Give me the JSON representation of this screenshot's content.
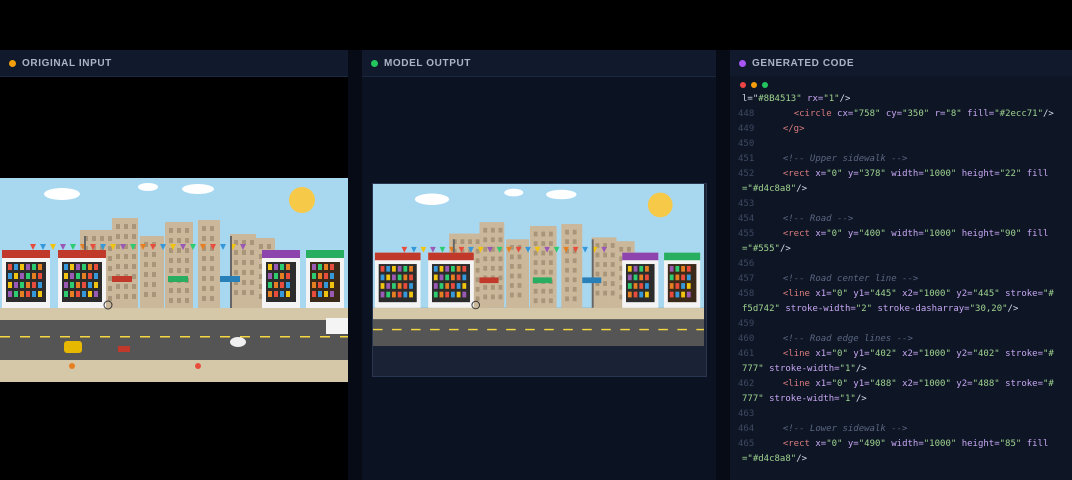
{
  "panels": {
    "input": {
      "title": "ORIGINAL INPUT",
      "dot_color": "#f59e0b"
    },
    "output": {
      "title": "MODEL OUTPUT",
      "dot_color": "#22c55e"
    },
    "code": {
      "title": "GENERATED CODE",
      "dot_color": "#a855f7"
    }
  },
  "scene": {
    "input_shops": [
      {
        "sign": "",
        "sign_color": "#c0392b"
      },
      {
        "sign": "",
        "sign_color": "#c0392b"
      },
      {
        "sign": "",
        "sign_color": "#8e44ad"
      },
      {
        "sign": "",
        "sign_color": "#27ae60"
      }
    ],
    "output_shops": [
      {
        "sign": "",
        "sign_color": "#c0392b"
      },
      {
        "sign": "",
        "sign_color": "#c0392b"
      },
      {
        "sign": "",
        "sign_color": "#8e44ad"
      },
      {
        "sign": "",
        "sign_color": "#27ae60"
      }
    ],
    "colors": {
      "sky": "#a7d8f0",
      "sun": "#f7c948",
      "road": "#555555",
      "sidewalk": "#d4c8a8",
      "building": "#cbb79a",
      "centerline": "#f5d742"
    }
  },
  "code_lines": [
    {
      "num": "",
      "indent": "cont",
      "parts": [
        [
          "txt",
          "l=\""
        ],
        [
          "val",
          "#8B4513\""
        ],
        [
          "attr",
          " rx="
        ],
        [
          "val",
          "\"1\""
        ],
        [
          "txt",
          "/>"
        ]
      ]
    },
    {
      "num": "448",
      "parts": [
        [
          "txt",
          "    "
        ],
        [
          "tag",
          "<circle"
        ],
        [
          "attr",
          " cx="
        ],
        [
          "val",
          "\"758\""
        ],
        [
          "attr",
          " cy="
        ],
        [
          "val",
          "\"350\""
        ],
        [
          "attr",
          " r="
        ],
        [
          "val",
          "\"8\""
        ],
        [
          "attr",
          " fill="
        ],
        [
          "val",
          "\"#2ecc71\""
        ],
        [
          "txt",
          "/>"
        ]
      ]
    },
    {
      "num": "449",
      "parts": [
        [
          "txt",
          "  "
        ],
        [
          "tag",
          "</g>"
        ]
      ]
    },
    {
      "num": "450",
      "parts": []
    },
    {
      "num": "451",
      "parts": [
        [
          "comment",
          "  <!-- Upper sidewalk -->"
        ]
      ]
    },
    {
      "num": "452",
      "parts": [
        [
          "txt",
          "  "
        ],
        [
          "tag",
          "<rect"
        ],
        [
          "attr",
          " x="
        ],
        [
          "val",
          "\"0\""
        ],
        [
          "attr",
          " y="
        ],
        [
          "val",
          "\"378\""
        ],
        [
          "attr",
          " width="
        ],
        [
          "val",
          "\"1000\""
        ],
        [
          "attr",
          " height="
        ],
        [
          "val",
          "\"22\""
        ],
        [
          "attr",
          " fill"
        ]
      ]
    },
    {
      "num": "",
      "indent": "cont",
      "parts": [
        [
          "val",
          "=\"#d4c8a8\""
        ],
        [
          "txt",
          "/>"
        ]
      ]
    },
    {
      "num": "453",
      "parts": []
    },
    {
      "num": "454",
      "parts": [
        [
          "comment",
          "  <!-- Road -->"
        ]
      ]
    },
    {
      "num": "455",
      "parts": [
        [
          "txt",
          "  "
        ],
        [
          "tag",
          "<rect"
        ],
        [
          "attr",
          " x="
        ],
        [
          "val",
          "\"0\""
        ],
        [
          "attr",
          " y="
        ],
        [
          "val",
          "\"400\""
        ],
        [
          "attr",
          " width="
        ],
        [
          "val",
          "\"1000\""
        ],
        [
          "attr",
          " height="
        ],
        [
          "val",
          "\"90\""
        ],
        [
          "attr",
          " fill"
        ]
      ]
    },
    {
      "num": "",
      "indent": "cont",
      "parts": [
        [
          "val",
          "=\"#555\""
        ],
        [
          "txt",
          "/>"
        ]
      ]
    },
    {
      "num": "456",
      "parts": []
    },
    {
      "num": "457",
      "parts": [
        [
          "comment",
          "  <!-- Road center line -->"
        ]
      ]
    },
    {
      "num": "458",
      "parts": [
        [
          "txt",
          "  "
        ],
        [
          "tag",
          "<line"
        ],
        [
          "attr",
          " x1="
        ],
        [
          "val",
          "\"0\""
        ],
        [
          "attr",
          " y1="
        ],
        [
          "val",
          "\"445\""
        ],
        [
          "attr",
          " x2="
        ],
        [
          "val",
          "\"1000\""
        ],
        [
          "attr",
          " y2="
        ],
        [
          "val",
          "\"445\""
        ],
        [
          "attr",
          " stroke="
        ],
        [
          "val",
          "\"#"
        ]
      ]
    },
    {
      "num": "",
      "indent": "cont",
      "parts": [
        [
          "val",
          "f5d742\""
        ],
        [
          "attr",
          " stroke-width="
        ],
        [
          "val",
          "\"2\""
        ],
        [
          "attr",
          " stroke-dasharray="
        ],
        [
          "val",
          "\"30,20\""
        ],
        [
          "txt",
          "/>"
        ]
      ]
    },
    {
      "num": "459",
      "parts": []
    },
    {
      "num": "460",
      "parts": [
        [
          "comment",
          "  <!-- Road edge lines -->"
        ]
      ]
    },
    {
      "num": "461",
      "parts": [
        [
          "txt",
          "  "
        ],
        [
          "tag",
          "<line"
        ],
        [
          "attr",
          " x1="
        ],
        [
          "val",
          "\"0\""
        ],
        [
          "attr",
          " y1="
        ],
        [
          "val",
          "\"402\""
        ],
        [
          "attr",
          " x2="
        ],
        [
          "val",
          "\"1000\""
        ],
        [
          "attr",
          " y2="
        ],
        [
          "val",
          "\"402\""
        ],
        [
          "attr",
          " stroke="
        ],
        [
          "val",
          "\"#"
        ]
      ]
    },
    {
      "num": "",
      "indent": "cont",
      "parts": [
        [
          "val",
          "777\""
        ],
        [
          "attr",
          " stroke-width="
        ],
        [
          "val",
          "\"1\""
        ],
        [
          "txt",
          "/>"
        ]
      ]
    },
    {
      "num": "462",
      "parts": [
        [
          "txt",
          "  "
        ],
        [
          "tag",
          "<line"
        ],
        [
          "attr",
          " x1="
        ],
        [
          "val",
          "\"0\""
        ],
        [
          "attr",
          " y1="
        ],
        [
          "val",
          "\"488\""
        ],
        [
          "attr",
          " x2="
        ],
        [
          "val",
          "\"1000\""
        ],
        [
          "attr",
          " y2="
        ],
        [
          "val",
          "\"488\""
        ],
        [
          "attr",
          " stroke="
        ],
        [
          "val",
          "\"#"
        ]
      ]
    },
    {
      "num": "",
      "indent": "cont",
      "parts": [
        [
          "val",
          "777\""
        ],
        [
          "attr",
          " stroke-width="
        ],
        [
          "val",
          "\"1\""
        ],
        [
          "txt",
          "/>"
        ]
      ]
    },
    {
      "num": "463",
      "parts": []
    },
    {
      "num": "464",
      "parts": [
        [
          "comment",
          "  <!-- Lower sidewalk -->"
        ]
      ]
    },
    {
      "num": "465",
      "parts": [
        [
          "txt",
          "  "
        ],
        [
          "tag",
          "<rect"
        ],
        [
          "attr",
          " x="
        ],
        [
          "val",
          "\"0\""
        ],
        [
          "attr",
          " y="
        ],
        [
          "val",
          "\"490\""
        ],
        [
          "attr",
          " width="
        ],
        [
          "val",
          "\"1000\""
        ],
        [
          "attr",
          " height="
        ],
        [
          "val",
          "\"85\""
        ],
        [
          "attr",
          " fill"
        ]
      ]
    },
    {
      "num": "",
      "indent": "cont",
      "parts": [
        [
          "val",
          "=\"#d4c8a8\""
        ],
        [
          "txt",
          "/>"
        ]
      ]
    }
  ]
}
